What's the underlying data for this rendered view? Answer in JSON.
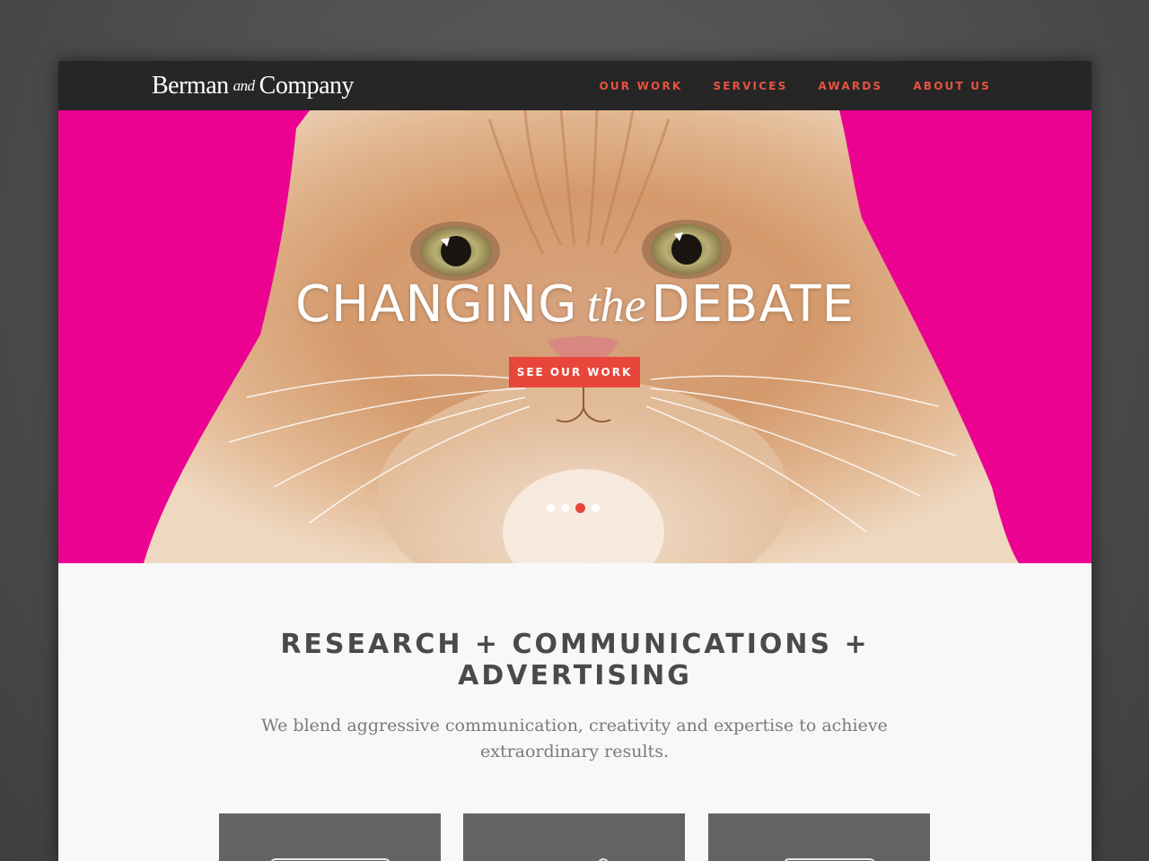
{
  "header": {
    "logo_main": "Berman",
    "logo_and": "and",
    "logo_company": "Company",
    "nav": [
      "OUR WORK",
      "SERVICES",
      "AWARDS",
      "ABOUT US"
    ]
  },
  "hero": {
    "title_left": "CHANGING",
    "title_mid": "the",
    "title_right": "DEBATE",
    "cta_label": "SEE OUR WORK",
    "slide_count": 4,
    "active_slide": 3,
    "background_color": "#ec0290"
  },
  "intro": {
    "headline_line1": "RESEARCH + COMMUNICATIONS +",
    "headline_line2": "ADVERTISING",
    "body_line1": "We blend aggressive communication, creativity and expertise to achieve",
    "body_line2": "extraordinary results."
  },
  "colors": {
    "accent": "#e8463a",
    "nav_bg": "#262626",
    "card_bg": "#636363"
  }
}
